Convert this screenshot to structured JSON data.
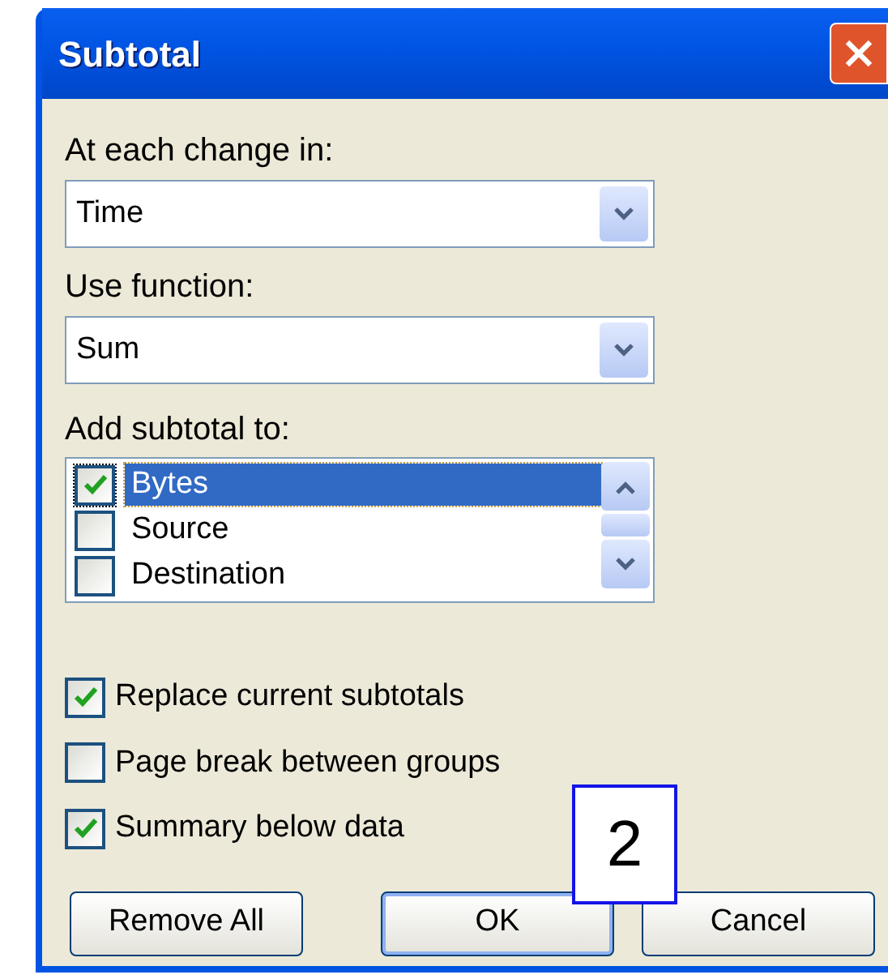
{
  "window": {
    "title": "Subtotal"
  },
  "change_field": {
    "label": "At each change in:",
    "value": "Time"
  },
  "function_field": {
    "label": "Use function:",
    "value": "Sum"
  },
  "subtotal_list": {
    "label": "Add subtotal to:",
    "items": [
      {
        "label": "Bytes",
        "checked": true,
        "selected": true
      },
      {
        "label": "Source",
        "checked": false,
        "selected": false
      },
      {
        "label": "Destination",
        "checked": false,
        "selected": false
      }
    ]
  },
  "options": [
    {
      "label": "Replace current subtotals",
      "checked": true
    },
    {
      "label": "Page break between groups",
      "checked": false
    },
    {
      "label": "Summary below data",
      "checked": true
    }
  ],
  "buttons": [
    {
      "label": "Remove All",
      "default": false
    },
    {
      "label": "OK",
      "default": true
    },
    {
      "label": "Cancel",
      "default": false
    }
  ],
  "callout": {
    "text": "2"
  }
}
